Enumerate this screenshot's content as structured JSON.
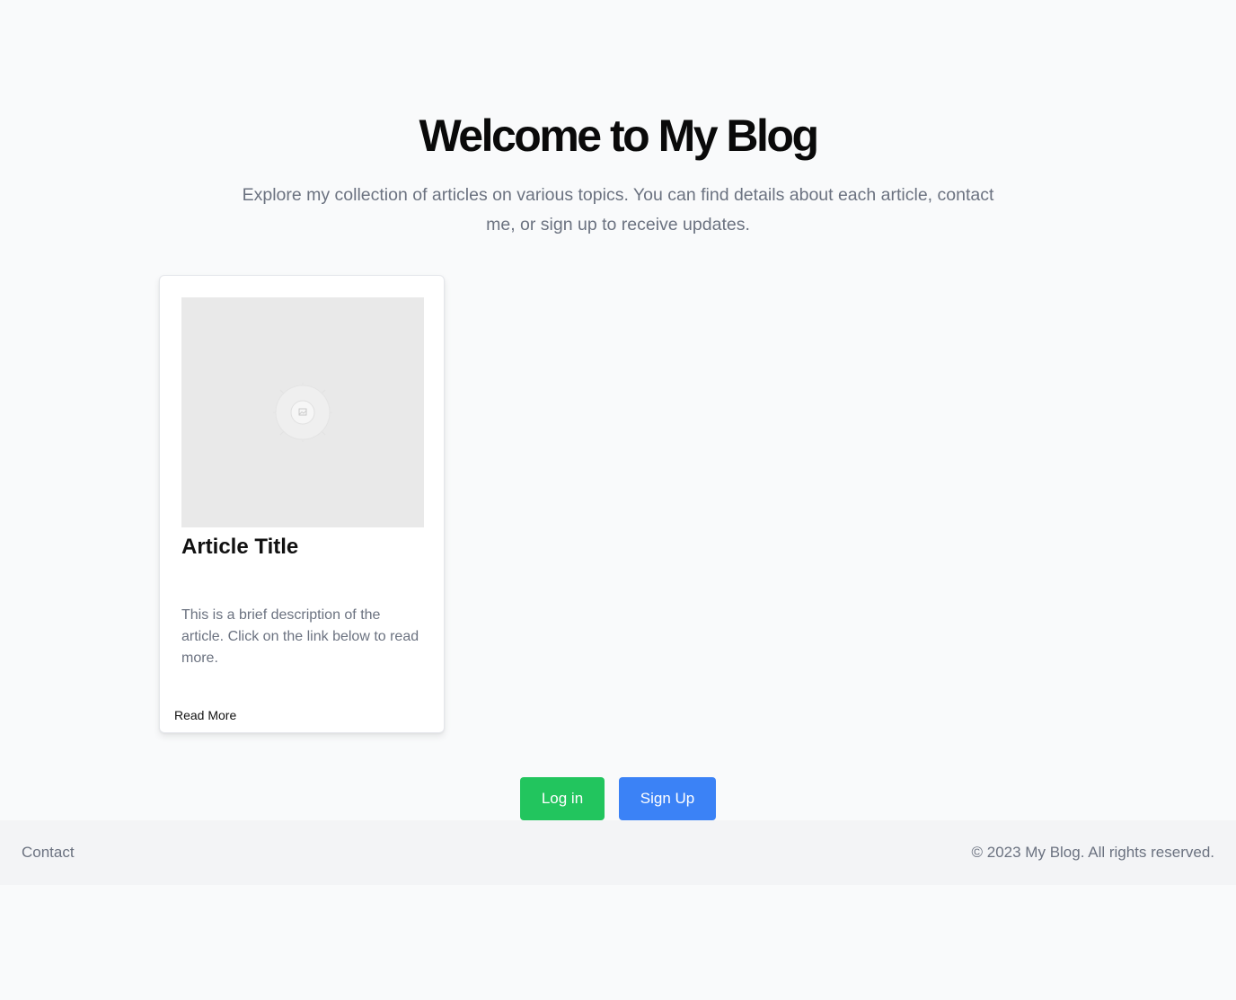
{
  "hero": {
    "title": "Welcome to My Blog",
    "subtitle": "Explore my collection of articles on various topics. You can find details about each article, contact me, or sign up to receive updates."
  },
  "article": {
    "image_icon": "image-placeholder-icon",
    "title": "Article Title",
    "description": "This is a brief description of the article. Click on the link below to read more.",
    "link_label": "Read More"
  },
  "actions": {
    "login_label": "Log in",
    "signup_label": "Sign Up",
    "login_color": "#22c55e",
    "signup_color": "#3b82f6"
  },
  "footer": {
    "contact_label": "Contact",
    "copyright": "© 2023 My Blog. All rights reserved."
  }
}
